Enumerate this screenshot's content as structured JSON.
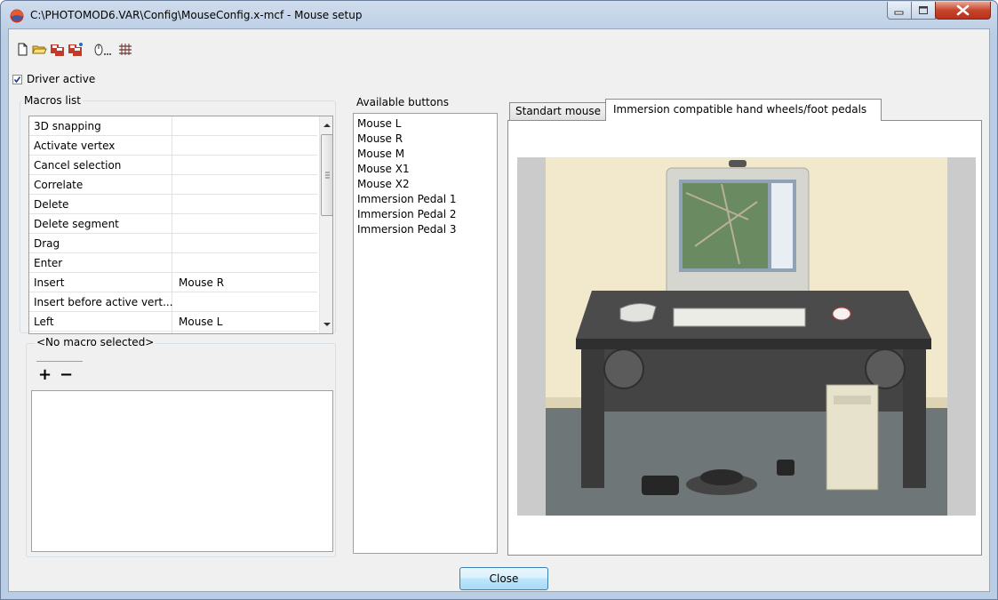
{
  "window": {
    "title": "C:\\PHOTOMOD6.VAR\\Config\\MouseConfig.x-mcf - Mouse setup",
    "controls": {
      "minimize": "minimize",
      "maximize": "maximize",
      "close": "close"
    }
  },
  "toolbar": {
    "icons": [
      "new-file-icon",
      "open-folder-icon",
      "save-icon",
      "save-as-icon",
      "mouse-settings-icon",
      "grid-icon"
    ]
  },
  "driver": {
    "label": "Driver active",
    "checked": true
  },
  "macros": {
    "group_label": "Macros list",
    "rows": [
      {
        "name": "3D snapping",
        "button": ""
      },
      {
        "name": "Activate vertex",
        "button": ""
      },
      {
        "name": "Cancel selection",
        "button": ""
      },
      {
        "name": "Correlate",
        "button": ""
      },
      {
        "name": "Delete",
        "button": ""
      },
      {
        "name": "Delete segment",
        "button": ""
      },
      {
        "name": "Drag",
        "button": ""
      },
      {
        "name": "Enter",
        "button": ""
      },
      {
        "name": "Insert",
        "button": "Mouse R"
      },
      {
        "name": "Insert before active vert...",
        "button": ""
      },
      {
        "name": "Left",
        "button": "Mouse L"
      }
    ]
  },
  "macro_detail": {
    "group_label": "<No macro selected>",
    "add_label": "+",
    "remove_label": "−"
  },
  "available": {
    "group_label": "Available buttons",
    "items": [
      "Mouse L",
      "Mouse R",
      "Mouse M",
      "Mouse X1",
      "Mouse X2",
      "Immersion Pedal 1",
      "Immersion Pedal 2",
      "Immersion Pedal 3"
    ]
  },
  "tabs": [
    {
      "label": "Standart mouse",
      "active": false
    },
    {
      "label": "Immersion compatible hand wheels/foot pedals",
      "active": true
    }
  ],
  "footer": {
    "close_label": "Close"
  },
  "colors": {
    "accent": "#3c7fb1",
    "close_red": "#c8442b",
    "frame": "#b9cde5"
  }
}
